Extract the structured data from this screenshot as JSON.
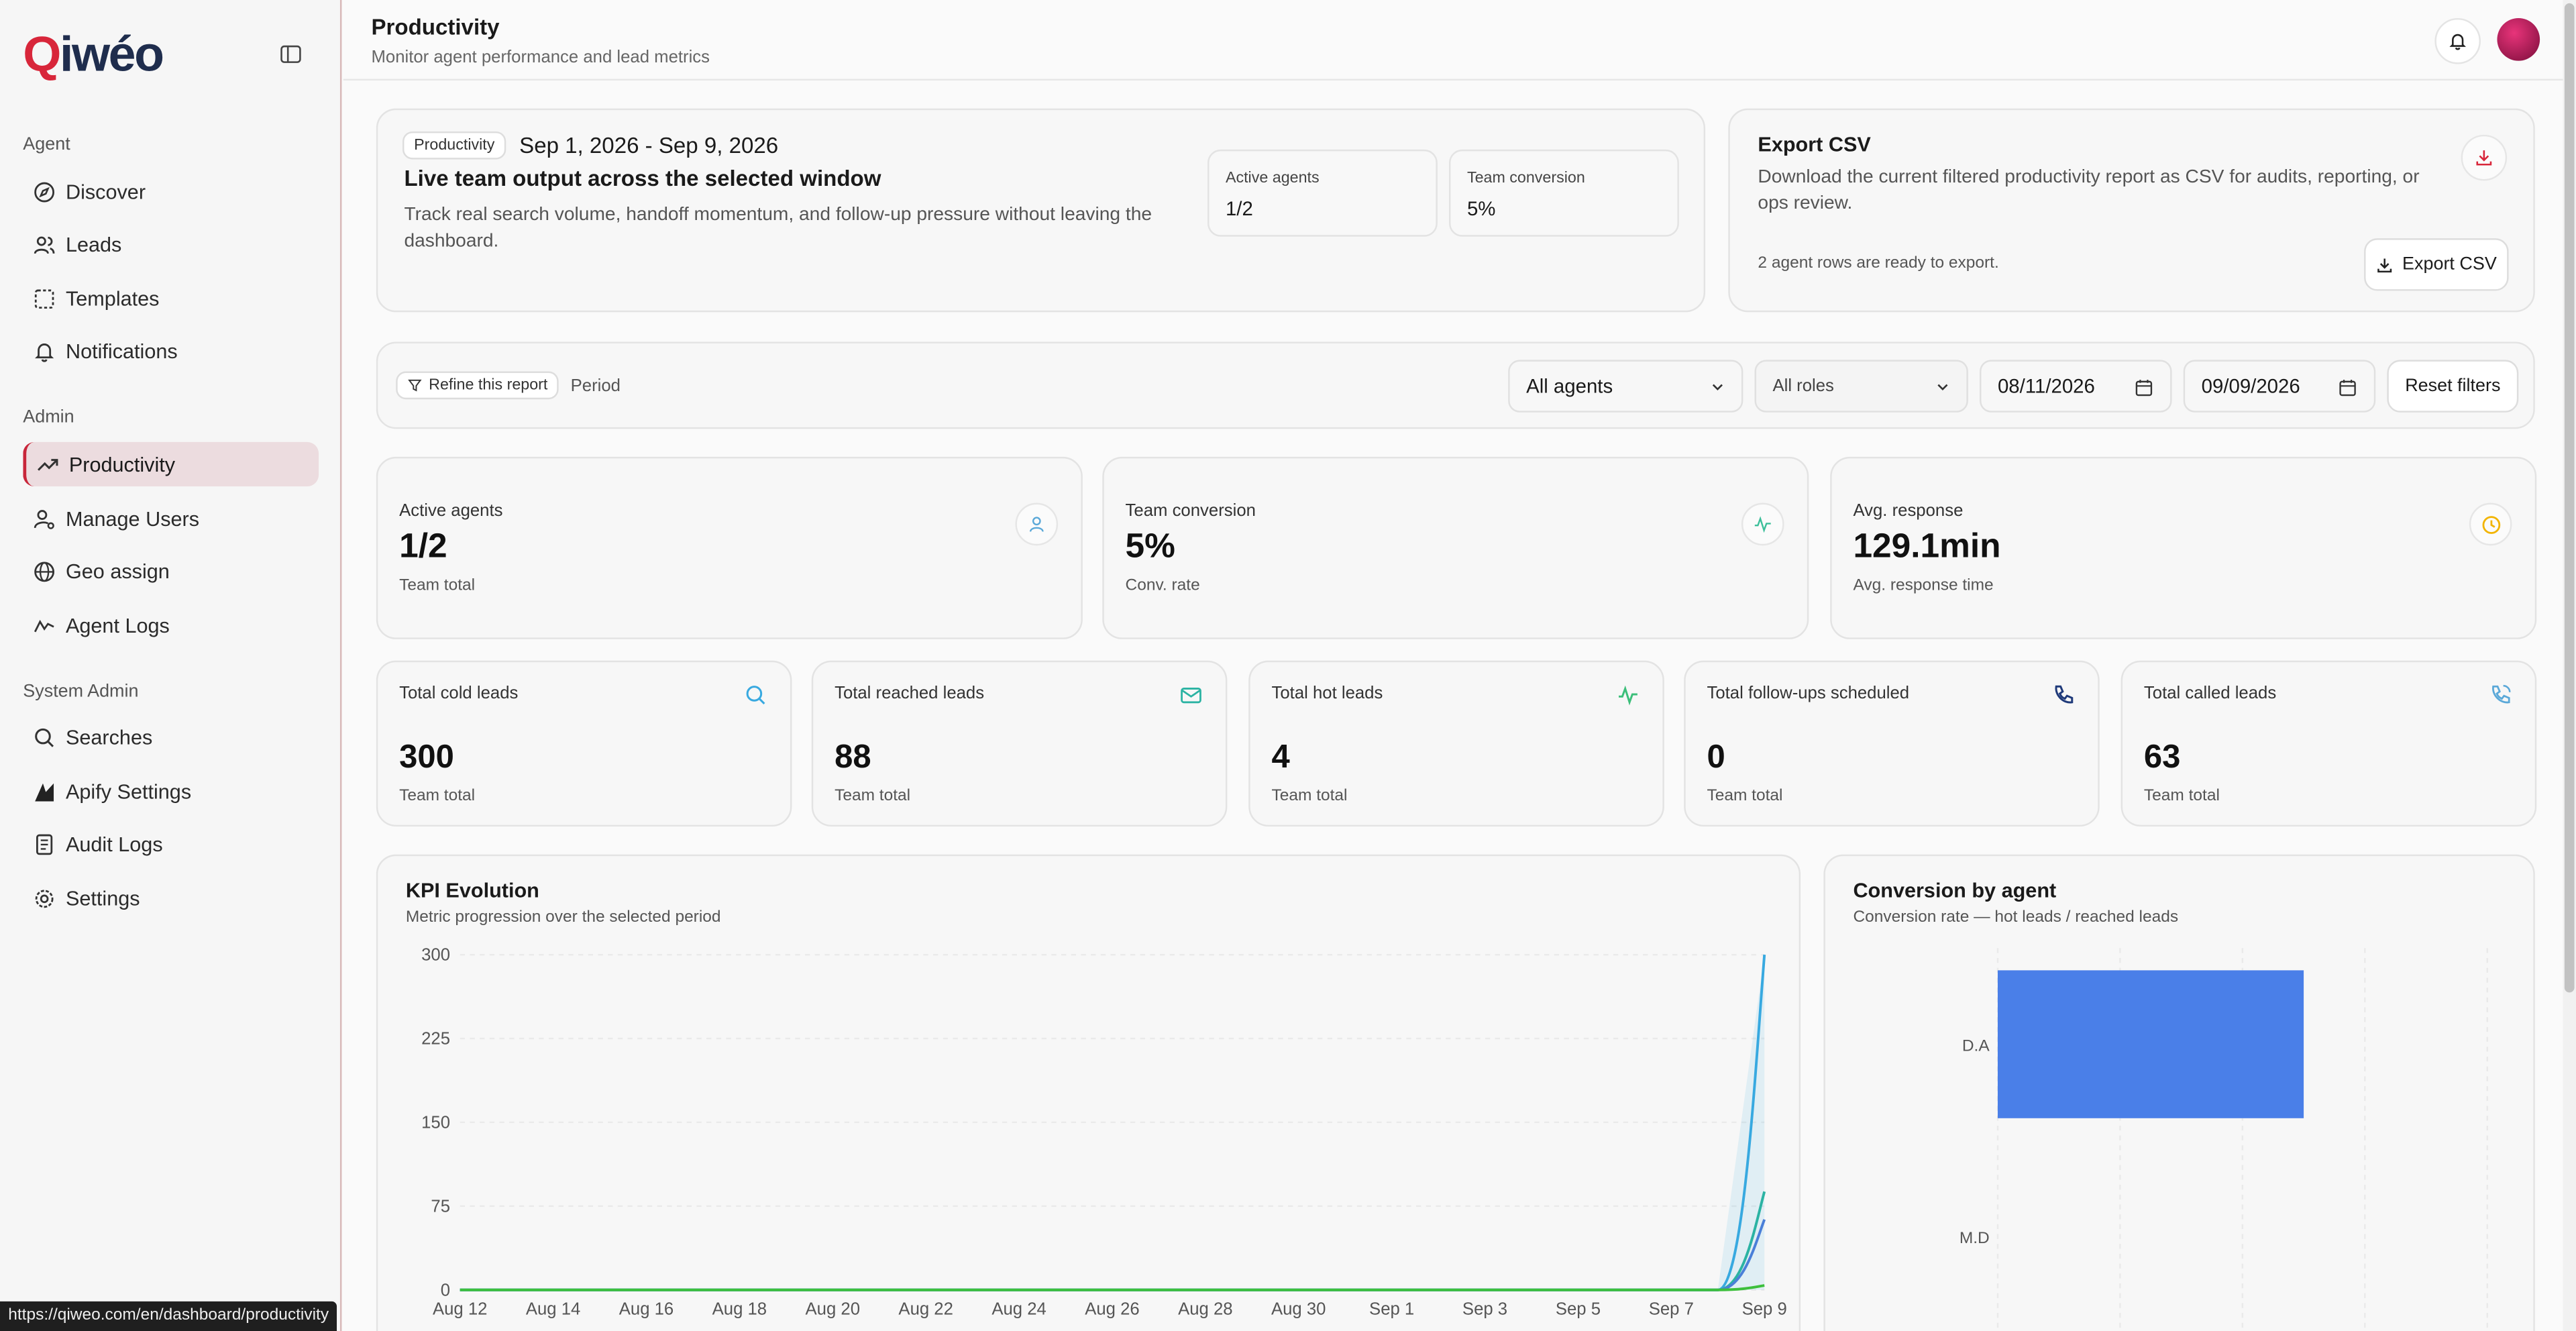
{
  "brand": {
    "logo_q": "Q",
    "logo_rest": "iwéo"
  },
  "sidebar": {
    "sections": [
      {
        "label": "Agent",
        "items": [
          {
            "label": "Discover",
            "icon": "compass-icon"
          },
          {
            "label": "Leads",
            "icon": "users-icon"
          },
          {
            "label": "Templates",
            "icon": "template-icon"
          },
          {
            "label": "Notifications",
            "icon": "bell-icon"
          }
        ]
      },
      {
        "label": "Admin",
        "items": [
          {
            "label": "Productivity",
            "icon": "trend-icon",
            "active": true
          },
          {
            "label": "Manage Users",
            "icon": "user-cog-icon"
          },
          {
            "label": "Geo assign",
            "icon": "globe-icon"
          },
          {
            "label": "Agent Logs",
            "icon": "activity-icon"
          }
        ]
      },
      {
        "label": "System Admin",
        "items": [
          {
            "label": "Searches",
            "icon": "search-icon"
          },
          {
            "label": "Apify Settings",
            "icon": "apify-icon"
          },
          {
            "label": "Audit Logs",
            "icon": "log-icon"
          },
          {
            "label": "Settings",
            "icon": "gear-icon"
          }
        ]
      }
    ]
  },
  "status_url": "https://qiweo.com/en/dashboard/productivity",
  "header": {
    "title": "Productivity",
    "subtitle": "Monitor agent performance and lead metrics"
  },
  "hero": {
    "pill": "Productivity",
    "date_range": "Sep 1, 2026 - Sep 9, 2026",
    "title": "Live team output across the selected window",
    "description": "Track real search volume, handoff momentum, and follow-up pressure without leaving the dashboard.",
    "mini": [
      {
        "label": "Active agents",
        "value": "1/2"
      },
      {
        "label": "Team conversion",
        "value": "5%"
      }
    ]
  },
  "export": {
    "title": "Export CSV",
    "description": "Download the current filtered productivity report as CSV for audits, reporting, or ops review.",
    "note": "2 agent rows are ready to export.",
    "button": "Export CSV"
  },
  "filters": {
    "refine_label": "Refine this report",
    "period_label": "Period",
    "agent_select": "All agents",
    "role_select": "All roles",
    "date_from": "08/11/2026",
    "date_to": "09/09/2026",
    "reset": "Reset filters"
  },
  "stats": [
    {
      "label": "Active agents",
      "value": "1/2",
      "sub": "Team total",
      "icon": "user-icon",
      "color": "#5aa8d8"
    },
    {
      "label": "Team conversion",
      "value": "5%",
      "sub": "Conv. rate",
      "icon": "pulse-icon",
      "color": "#3cbf9a"
    },
    {
      "label": "Avg. response",
      "value": "129.1min",
      "sub": "Avg. response time",
      "icon": "clock-icon",
      "color": "#f2b400"
    }
  ],
  "kpis": [
    {
      "label": "Total cold leads",
      "value": "300",
      "sub": "Team total",
      "icon": "search-icon",
      "color": "#38a9e0"
    },
    {
      "label": "Total reached leads",
      "value": "88",
      "sub": "Team total",
      "icon": "mail-icon",
      "color": "#2bb3a3"
    },
    {
      "label": "Total hot leads",
      "value": "4",
      "sub": "Team total",
      "icon": "pulse-icon",
      "color": "#3cbf7a"
    },
    {
      "label": "Total follow-ups scheduled",
      "value": "0",
      "sub": "Team total",
      "icon": "phone-icon",
      "color": "#1f3a7a"
    },
    {
      "label": "Total called leads",
      "value": "63",
      "sub": "Team total",
      "icon": "phone-call-icon",
      "color": "#5aa8d8"
    }
  ],
  "chart_data": [
    {
      "type": "line",
      "title": "KPI Evolution",
      "subtitle": "Metric progression over the selected period",
      "x": [
        "Aug 12",
        "Aug 13",
        "Aug 14",
        "Aug 15",
        "Aug 16",
        "Aug 17",
        "Aug 18",
        "Aug 19",
        "Aug 20",
        "Aug 21",
        "Aug 22",
        "Aug 23",
        "Aug 24",
        "Aug 25",
        "Aug 26",
        "Aug 27",
        "Aug 28",
        "Aug 29",
        "Aug 30",
        "Aug 31",
        "Sep 1",
        "Sep 2",
        "Sep 3",
        "Sep 4",
        "Sep 5",
        "Sep 6",
        "Sep 7",
        "Sep 8",
        "Sep 9"
      ],
      "x_tick_labels": [
        "Aug 12",
        "Aug 14",
        "Aug 16",
        "Aug 18",
        "Aug 20",
        "Aug 22",
        "Aug 24",
        "Aug 26",
        "Aug 28",
        "Aug 30",
        "Sep 1",
        "Sep 3",
        "Sep 5",
        "Sep 7",
        "Sep 9"
      ],
      "y_ticks": [
        0,
        75,
        150,
        225,
        300
      ],
      "ylim": [
        0,
        300
      ],
      "series": [
        {
          "color": "#38a9e0",
          "values": [
            0,
            0,
            0,
            0,
            0,
            0,
            0,
            0,
            0,
            0,
            0,
            0,
            0,
            0,
            0,
            0,
            0,
            0,
            0,
            0,
            0,
            0,
            0,
            0,
            0,
            0,
            0,
            0,
            300
          ]
        },
        {
          "color": "#2bb3a3",
          "values": [
            0,
            0,
            0,
            0,
            0,
            0,
            0,
            0,
            0,
            0,
            0,
            0,
            0,
            0,
            0,
            0,
            0,
            0,
            0,
            0,
            0,
            0,
            0,
            0,
            0,
            0,
            0,
            0,
            88
          ]
        },
        {
          "color": "#4a7fd8",
          "values": [
            0,
            0,
            0,
            0,
            0,
            0,
            0,
            0,
            0,
            0,
            0,
            0,
            0,
            0,
            0,
            0,
            0,
            0,
            0,
            0,
            0,
            0,
            0,
            0,
            0,
            0,
            0,
            0,
            63
          ]
        },
        {
          "color": "#3cbf3c",
          "values": [
            0,
            0,
            0,
            0,
            0,
            0,
            0,
            0,
            0,
            0,
            0,
            0,
            0,
            0,
            0,
            0,
            0,
            0,
            0,
            0,
            0,
            0,
            0,
            0,
            0,
            0,
            0,
            0,
            4
          ]
        }
      ]
    },
    {
      "type": "bar",
      "orientation": "horizontal",
      "title": "Conversion by agent",
      "subtitle": "Conversion rate — hot leads / reached leads",
      "categories": [
        "D.A",
        "M.D"
      ],
      "values": [
        5,
        0
      ],
      "xlim": [
        0,
        8
      ],
      "color": "#4a7fe8"
    }
  ]
}
